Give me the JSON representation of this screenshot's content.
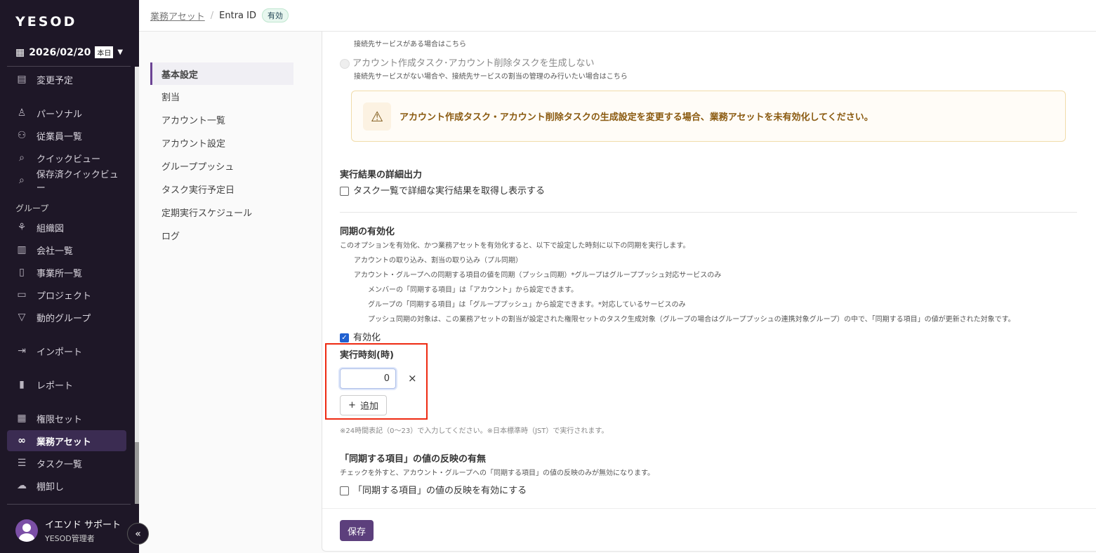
{
  "sidebar": {
    "logo": "YESOD",
    "date": "2026/02/20",
    "today_badge": "本日",
    "group_label": "グループ",
    "items": [
      {
        "label": "変更予定",
        "icon": "file-check-icon"
      },
      {
        "label": "パーソナル",
        "icon": "person-icon"
      },
      {
        "label": "従業員一覧",
        "icon": "people-icon"
      },
      {
        "label": "クイックビュー",
        "icon": "search-icon"
      },
      {
        "label": "保存済クイックビュー",
        "icon": "search-icon"
      },
      {
        "label": "組織図",
        "icon": "org-chart-icon"
      },
      {
        "label": "会社一覧",
        "icon": "building-icon"
      },
      {
        "label": "事業所一覧",
        "icon": "office-icon"
      },
      {
        "label": "プロジェクト",
        "icon": "briefcase-icon"
      },
      {
        "label": "動的グループ",
        "icon": "filter-icon"
      },
      {
        "label": "インポート",
        "icon": "import-icon"
      },
      {
        "label": "レポート",
        "icon": "bar-chart-icon"
      },
      {
        "label": "権限セット",
        "icon": "grid-icon"
      },
      {
        "label": "業務アセット",
        "icon": "link-icon",
        "active": true
      },
      {
        "label": "タスク一覧",
        "icon": "checklist-icon"
      },
      {
        "label": "棚卸し",
        "icon": "cloud-download-icon"
      }
    ],
    "user": {
      "name": "イエソド サポート",
      "role": "YESOD管理者"
    }
  },
  "header": {
    "crumb": "業務アセット",
    "separator": "/",
    "current": "Entra ID",
    "status": "有効"
  },
  "subnav": [
    "基本設定",
    "割当",
    "アカウント一覧",
    "アカウント設定",
    "グループプッシュ",
    "タスク実行予定日",
    "定期実行スケジュール",
    "ログ"
  ],
  "main": {
    "opt1_desc": "接続先サービスがある場合はこちら",
    "opt2_label": "アカウント作成タスク･アカウント削除タスクを生成しない",
    "opt2_desc": "接続先サービスがない場合や、接続先サービスの割当の管理のみ行いたい場合はこちら",
    "warning": "アカウント作成タスク・アカウント削除タスクの生成設定を変更する場合、業務アセットを未有効化してください。",
    "detail_title": "実行結果の詳細出力",
    "detail_checkbox": "タスク一覧で詳細な実行結果を取得し表示する",
    "sync_title": "同期の有効化",
    "sync_desc": "このオプションを有効化、かつ業務アセットを有効化すると、以下で設定した時刻に以下の同期を実行します。",
    "sync_l1": "アカウントの取り込み、割当の取り込み（プル同期）",
    "sync_l2": "アカウント・グループへの同期する項目の値を同期（プッシュ同期）*グループはグループプッシュ対応サービスのみ",
    "sync_l3": "メンバーの「同期する項目」は「アカウント」から設定できます。",
    "sync_l4": "グループの「同期する項目」は「グループプッシュ」から設定できます。*対応しているサービスのみ",
    "sync_l5": "プッシュ同期の対象は、この業務アセットの割当が設定された権限セットのタスク生成対象（グループの場合はグループプッシュの連携対象グループ）の中で、「同期する項目」の値が更新された対象です。",
    "enable_label": "有効化",
    "time_title": "実行時刻(時)",
    "time_value": "0",
    "remove": "×",
    "add_label": "追加",
    "time_note": "※24時間表記（0〜23）で入力してください。※日本標準時（JST）で実行されます。",
    "reflect_title": "「同期する項目」の値の反映の有無",
    "reflect_desc": "チェックを外すと、アカウント・グループへの「同期する項目」の値の反映のみが無効になります。",
    "reflect_checkbox": "「同期する項目」の値の反映を有効にする",
    "save": "保存"
  }
}
